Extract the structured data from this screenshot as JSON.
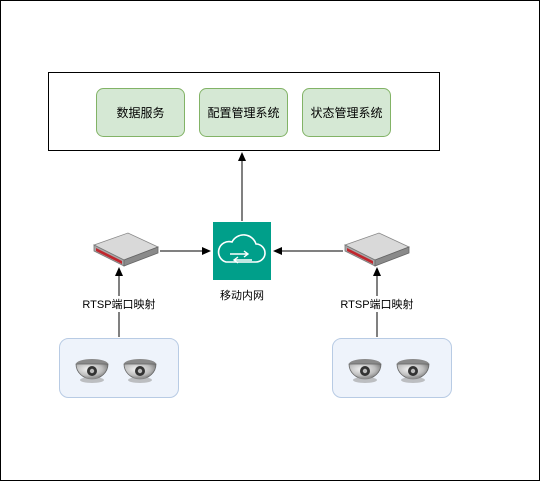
{
  "top_services": [
    {
      "label": "数据服务"
    },
    {
      "label": "配置管理系统"
    },
    {
      "label": "状态管理系统"
    }
  ],
  "network": {
    "label": "移动内网",
    "icon": "cloud-network-icon"
  },
  "left_group": {
    "mapping_label": "RTSP端口映射",
    "router_icon": "router-icon",
    "camera_icon": "dome-camera-icon"
  },
  "right_group": {
    "mapping_label": "RTSP端口映射",
    "router_icon": "router-icon",
    "camera_icon": "dome-camera-icon"
  },
  "colors": {
    "service_fill": "#d5e8d4",
    "service_stroke": "#82b366",
    "camera_group_fill": "#eef3fb",
    "camera_group_stroke": "#b8cbe4",
    "network_tile": "#009f8a",
    "router_accent": "#c0262d"
  }
}
